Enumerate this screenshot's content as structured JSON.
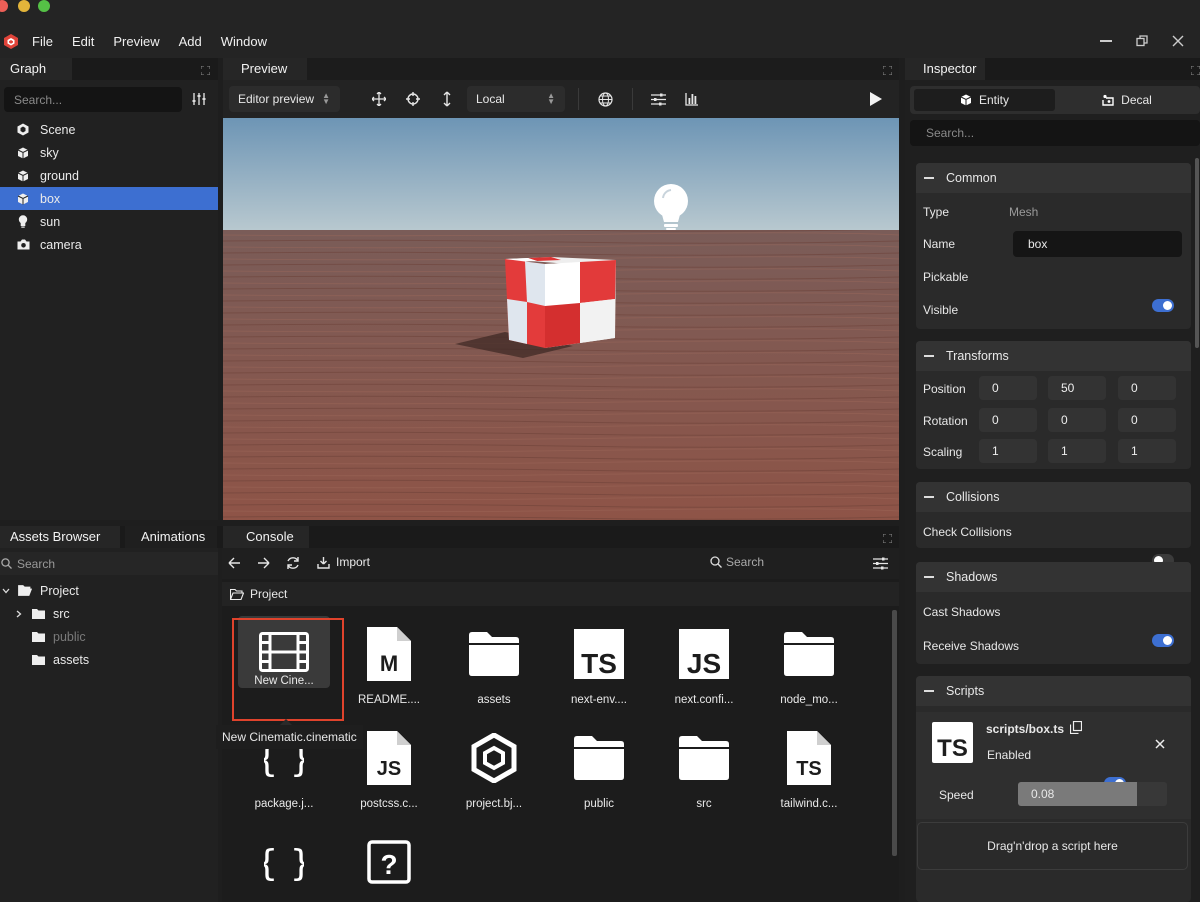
{
  "menu": [
    "File",
    "Edit",
    "Preview",
    "Add",
    "Window"
  ],
  "graph": {
    "title": "Graph",
    "search_placeholder": "Search...",
    "items": [
      {
        "label": "Scene",
        "icon": "scene-icon"
      },
      {
        "label": "sky",
        "icon": "cube-icon"
      },
      {
        "label": "ground",
        "icon": "cube-icon"
      },
      {
        "label": "box",
        "icon": "cube-icon",
        "selected": true
      },
      {
        "label": "sun",
        "icon": "lightbulb-icon"
      },
      {
        "label": "camera",
        "icon": "camera-icon"
      }
    ]
  },
  "preview": {
    "title": "Preview",
    "camera_select": "Editor preview",
    "space_select": "Local"
  },
  "inspector": {
    "title": "Inspector",
    "tab_entity": "Entity",
    "tab_decal": "Decal",
    "search_placeholder": "Search...",
    "common": {
      "title": "Common",
      "type_label": "Type",
      "type_value": "Mesh",
      "name_label": "Name",
      "name_value": "box",
      "pickable_label": "Pickable",
      "pickable": true,
      "visible_label": "Visible",
      "visible": true
    },
    "transforms": {
      "title": "Transforms",
      "rows": [
        {
          "label": "Position",
          "values": [
            "0",
            "50",
            "0"
          ]
        },
        {
          "label": "Rotation",
          "values": [
            "0",
            "0",
            "0"
          ]
        },
        {
          "label": "Scaling",
          "values": [
            "1",
            "1",
            "1"
          ]
        }
      ]
    },
    "collisions": {
      "title": "Collisions",
      "check_label": "Check Collisions",
      "check": false
    },
    "shadows": {
      "title": "Shadows",
      "cast_label": "Cast Shadows",
      "cast": true,
      "receive_label": "Receive Shadows",
      "receive": true
    },
    "scripts": {
      "title": "Scripts",
      "script_name": "scripts/box.ts",
      "badge": "TS",
      "enabled_label": "Enabled",
      "enabled": true,
      "speed_label": "Speed",
      "speed_value": "0.08",
      "speed_fill": 0.8,
      "drop_hint": "Drag'n'drop a script here"
    }
  },
  "bottom_tabs": {
    "assets": "Assets Browser",
    "animations": "Animations",
    "console": "Console"
  },
  "assets": {
    "search_placeholder": "Search",
    "tree": {
      "root": "Project",
      "children": [
        {
          "label": "src",
          "expandable": true,
          "dim": false
        },
        {
          "label": "public",
          "expandable": false,
          "dim": true
        },
        {
          "label": "assets",
          "expandable": false,
          "dim": false
        }
      ]
    },
    "import_label": "Import",
    "search_right": "Search",
    "breadcrumb": "Project",
    "tooltip": "New Cinematic.cinematic",
    "files": [
      {
        "label": "New Cine...",
        "kind": "film",
        "selected": true
      },
      {
        "label": "README....",
        "kind": "doc",
        "badge": "M"
      },
      {
        "label": "assets",
        "kind": "folder"
      },
      {
        "label": "next-env....",
        "kind": "badge",
        "badge": "TS"
      },
      {
        "label": "next.confi...",
        "kind": "badge",
        "badge": "JS"
      },
      {
        "label": "node_mo...",
        "kind": "folder"
      },
      {
        "label": "package.j...",
        "kind": "braces"
      },
      {
        "label": "postcss.c...",
        "kind": "doc",
        "badge": "JS"
      },
      {
        "label": "project.bj...",
        "kind": "hex"
      },
      {
        "label": "public",
        "kind": "folder"
      },
      {
        "label": "src",
        "kind": "folder"
      },
      {
        "label": "tailwind.c...",
        "kind": "doc",
        "badge": "TS"
      },
      {
        "label": "",
        "kind": "braces"
      },
      {
        "label": "",
        "kind": "unknown"
      }
    ]
  },
  "colors": {
    "accent": "#3d6fd1",
    "selection_outline": "#e0432c",
    "sky_top": "#6e97b8",
    "ground": "#8a5a4e"
  }
}
